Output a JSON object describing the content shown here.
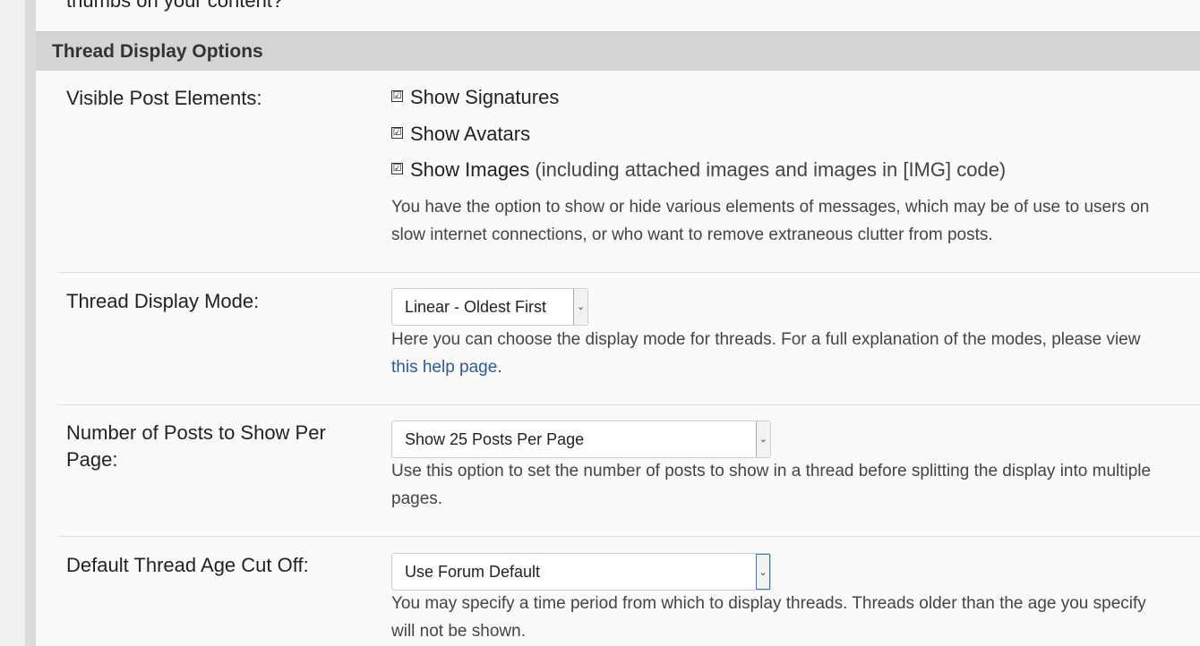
{
  "prev_question_text": "thumbs on your content?",
  "section": {
    "title": "Thread Display Options"
  },
  "visible_elements": {
    "label": "Visible Post Elements:",
    "options": [
      {
        "label": "Show Signatures",
        "note": "",
        "checked": true
      },
      {
        "label": "Show Avatars",
        "note": "",
        "checked": true
      },
      {
        "label": "Show Images",
        "note": "(including attached images and images in [IMG] code)",
        "checked": true
      }
    ],
    "check_glyph": "☑",
    "description": "You have the option to show or hide various elements of messages, which may be of use to users on slow internet connections, or who want to remove extraneous clutter from posts."
  },
  "display_mode": {
    "label": "Thread Display Mode:",
    "selected": "Linear - Oldest First",
    "description_prefix": "Here you can choose the display mode for threads. For a full explanation of the modes, please view ",
    "help_link": "this help page",
    "description_suffix": "."
  },
  "posts_per_page": {
    "label": "Number of Posts to Show Per Page:",
    "selected": "Show 25 Posts Per Page",
    "description": "Use this option to set the number of posts to show in a thread before splitting the display into multiple pages."
  },
  "age_cutoff": {
    "label": "Default Thread Age Cut Off:",
    "selected": "Use Forum Default",
    "description": "You may specify a time period from which to display threads. Threads older than the age you specify will not be shown."
  },
  "icons": {
    "dropdown_arrow": "⌄"
  }
}
